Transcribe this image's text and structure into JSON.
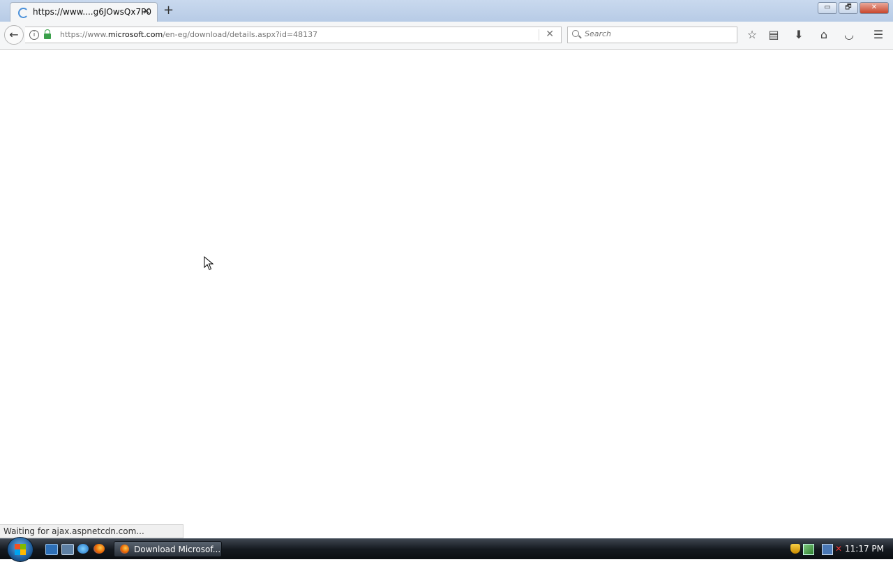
{
  "browser": {
    "tab": {
      "title": "https://www....g6JOwsQx7P0",
      "close_glyph": "×"
    },
    "new_tab_glyph": "+",
    "window_controls": {
      "minimize": "▭",
      "restore": "🗗",
      "close": "✕"
    },
    "nav": {
      "back_glyph": "←",
      "url_prefix": "https://www.",
      "url_domain": "microsoft.com",
      "url_path": "/en-eg/download/details.aspx?id=48137",
      "clear_glyph": "✕",
      "search_placeholder": "Search"
    },
    "toolbar_icons": [
      "star-icon",
      "reading-list-icon",
      "download-arrow-icon",
      "home-icon",
      "pocket-icon",
      "menu-icon"
    ],
    "status_text": "Waiting for ajax.aspnetcdn.com..."
  },
  "taskbar": {
    "task_button_label": "Download Microsof...",
    "clock": "11:17 PM"
  },
  "colors": {
    "accent": "#4a90d9",
    "lock": "#3aa04a",
    "taskbar": "#151a20"
  }
}
